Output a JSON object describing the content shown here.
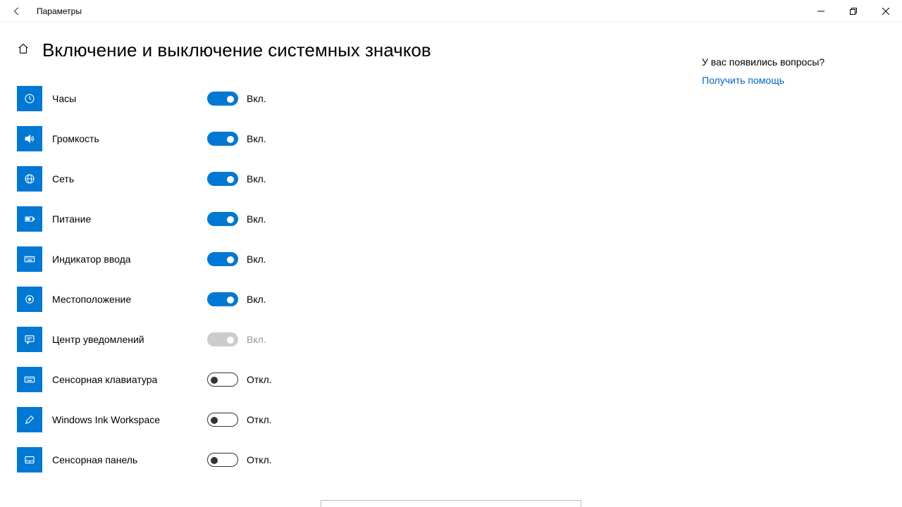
{
  "window": {
    "title": "Параметры"
  },
  "page": {
    "title": "Включение и выключение системных значков"
  },
  "labels": {
    "on": "Вкл.",
    "off": "Откл."
  },
  "items": [
    {
      "key": "clock",
      "label": "Часы",
      "state": "on",
      "disabled": false,
      "icon": "clock"
    },
    {
      "key": "volume",
      "label": "Громкость",
      "state": "on",
      "disabled": false,
      "icon": "volume"
    },
    {
      "key": "network",
      "label": "Сеть",
      "state": "on",
      "disabled": false,
      "icon": "globe"
    },
    {
      "key": "power",
      "label": "Питание",
      "state": "on",
      "disabled": false,
      "icon": "battery"
    },
    {
      "key": "input",
      "label": "Индикатор ввода",
      "state": "on",
      "disabled": false,
      "icon": "keyboard"
    },
    {
      "key": "location",
      "label": "Местоположение",
      "state": "on",
      "disabled": false,
      "icon": "target"
    },
    {
      "key": "action",
      "label": "Центр уведомлений",
      "state": "on",
      "disabled": true,
      "icon": "message"
    },
    {
      "key": "touchkbd",
      "label": "Сенсорная клавиатура",
      "state": "off",
      "disabled": false,
      "icon": "keyboard"
    },
    {
      "key": "ink",
      "label": "Windows Ink Workspace",
      "state": "off",
      "disabled": false,
      "icon": "pen"
    },
    {
      "key": "touchpad",
      "label": "Сенсорная панель",
      "state": "off",
      "disabled": false,
      "icon": "touchpad"
    }
  ],
  "help": {
    "question": "У вас появились вопросы?",
    "link": "Получить помощь"
  }
}
